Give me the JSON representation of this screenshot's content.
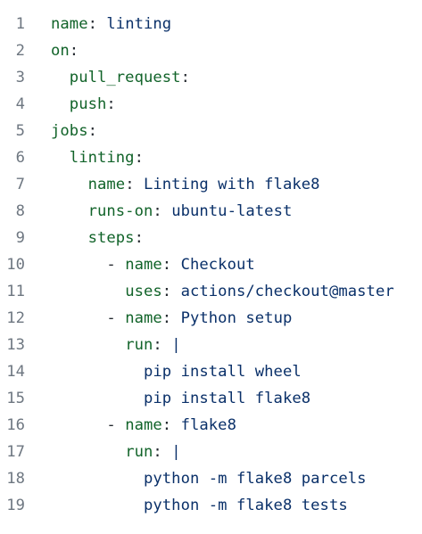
{
  "editor": {
    "lines": [
      {
        "number": "1",
        "indent": "",
        "key": "name",
        "colon": ":",
        "value": " linting"
      },
      {
        "number": "2",
        "indent": "",
        "key": "on",
        "colon": ":",
        "value": ""
      },
      {
        "number": "3",
        "indent": "  ",
        "key": "pull_request",
        "colon": ":",
        "value": ""
      },
      {
        "number": "4",
        "indent": "  ",
        "key": "push",
        "colon": ":",
        "value": ""
      },
      {
        "number": "5",
        "indent": "",
        "key": "jobs",
        "colon": ":",
        "value": ""
      },
      {
        "number": "6",
        "indent": "  ",
        "key": "linting",
        "colon": ":",
        "value": ""
      },
      {
        "number": "7",
        "indent": "    ",
        "key": "name",
        "colon": ":",
        "value": " Linting with flake8"
      },
      {
        "number": "8",
        "indent": "    ",
        "key": "runs-on",
        "colon": ":",
        "value": " ubuntu-latest"
      },
      {
        "number": "9",
        "indent": "    ",
        "key": "steps",
        "colon": ":",
        "value": ""
      },
      {
        "number": "10",
        "indent": "      - ",
        "key": "name",
        "colon": ":",
        "value": " Checkout"
      },
      {
        "number": "11",
        "indent": "        ",
        "key": "uses",
        "colon": ":",
        "value": " actions/checkout@master"
      },
      {
        "number": "12",
        "indent": "      - ",
        "key": "name",
        "colon": ":",
        "value": " Python setup"
      },
      {
        "number": "13",
        "indent": "        ",
        "key": "run",
        "colon": ":",
        "value": " |"
      },
      {
        "number": "14",
        "indent": "          ",
        "key": "",
        "colon": "",
        "value": "pip install wheel"
      },
      {
        "number": "15",
        "indent": "          ",
        "key": "",
        "colon": "",
        "value": "pip install flake8"
      },
      {
        "number": "16",
        "indent": "      - ",
        "key": "name",
        "colon": ":",
        "value": " flake8"
      },
      {
        "number": "17",
        "indent": "        ",
        "key": "run",
        "colon": ":",
        "value": " |"
      },
      {
        "number": "18",
        "indent": "          ",
        "key": "",
        "colon": "",
        "value": "python -m flake8 parcels"
      },
      {
        "number": "19",
        "indent": "          ",
        "key": "",
        "colon": "",
        "value": "python -m flake8 tests"
      }
    ]
  },
  "colors": {
    "line_number": "#6e7781",
    "key": "#116329",
    "value": "#0a3069",
    "punctuation": "#24292f",
    "background": "#ffffff"
  }
}
